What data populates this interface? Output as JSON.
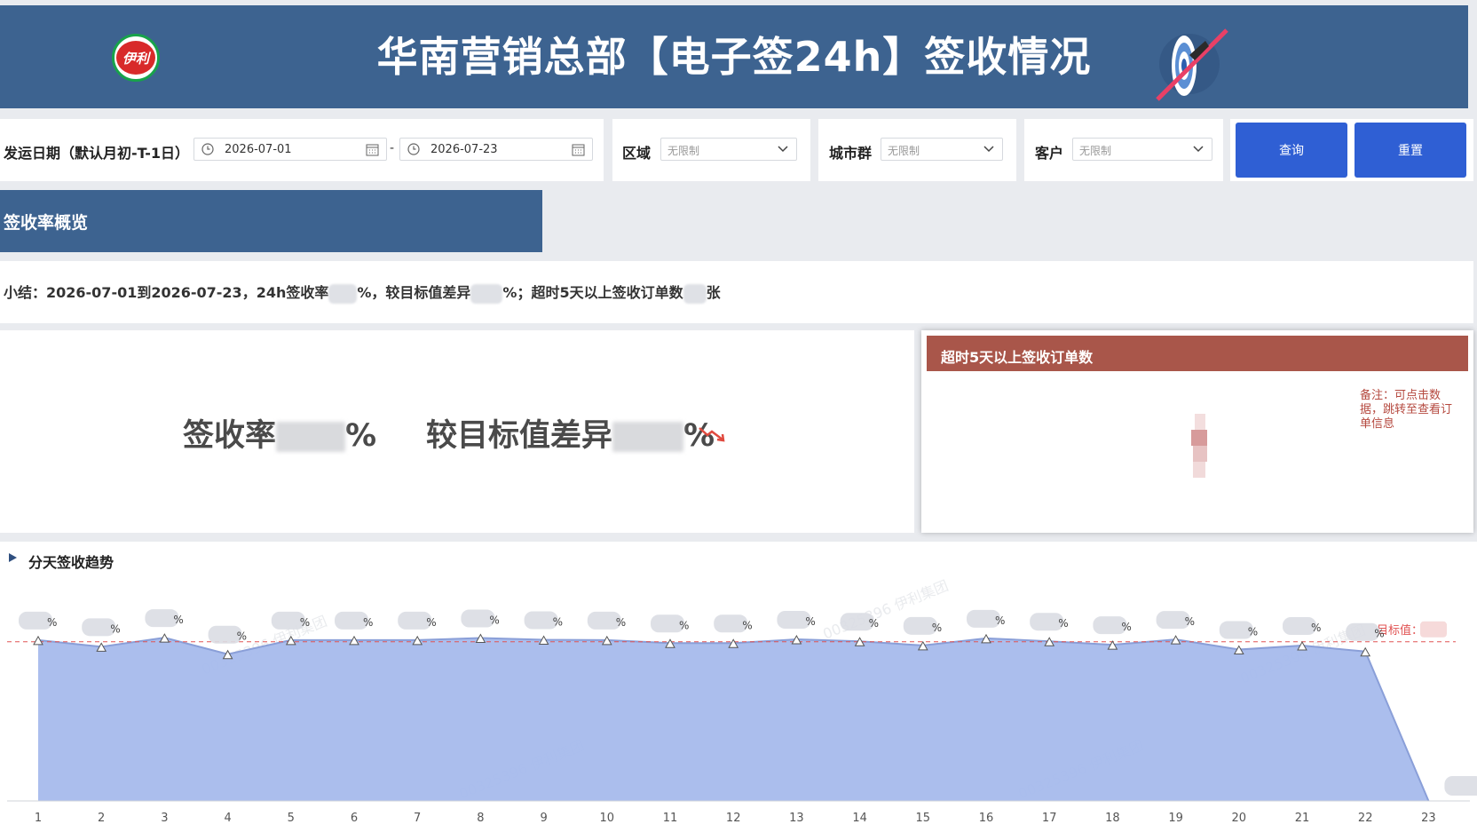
{
  "header": {
    "logo_text": "伊利",
    "title": "华南营销总部【电子签24h】签收情况"
  },
  "filters": {
    "date_label": "发运日期（默认月初-T-1日）",
    "start_date": "2026-07-01",
    "date_separator": "-",
    "end_date": "2026-07-23",
    "region_label": "区域",
    "region_value": "无限制",
    "city_label": "城市群",
    "city_value": "无限制",
    "customer_label": "客户",
    "customer_value": "无限制",
    "query_label": "查询",
    "reset_label": "重置"
  },
  "overview": {
    "section_title": "签收率概览",
    "summary_part1": "小结：2026-07-01到2026-07-23，24h签收率",
    "summary_part2": "%，较目标值差异",
    "summary_part3": "%；超时5天以上签收订单数",
    "summary_part4": "张",
    "kpi_rate_label": "签收率",
    "kpi_rate_unit": "%",
    "kpi_diff_label": "较目标值差异",
    "kpi_diff_unit": "%",
    "trend_icon": "trend-down-icon",
    "accent_color": "#3d6390"
  },
  "overtime": {
    "title": "超时5天以上签收订单数",
    "note": "备注：可点击数据，跳转至查看订单信息",
    "header_color": "#a9564a"
  },
  "trend": {
    "title": "分天签收趋势",
    "target_label": "目标值：",
    "watermark": "00325396 伊利集团"
  },
  "chart_data": {
    "type": "area",
    "title": "分天签收趋势",
    "categories": [
      "1",
      "2",
      "3",
      "4",
      "5",
      "6",
      "7",
      "8",
      "9",
      "10",
      "11",
      "12",
      "13",
      "14",
      "15",
      "16",
      "17",
      "18",
      "19",
      "20",
      "21",
      "22",
      "23"
    ],
    "series": [
      {
        "values": [
          97.5,
          93.5,
          99.0,
          89.0,
          97.5,
          97.5,
          97.5,
          98.8,
          97.7,
          97.5,
          95.7,
          95.7,
          98.0,
          96.8,
          94.3,
          98.6,
          96.8,
          94.7,
          97.9,
          91.8,
          94.2,
          90.6,
          0
        ],
        "color": "#a7bbec",
        "line_color": "#8a9fd8"
      }
    ],
    "target_line": {
      "value": 96.5,
      "color": "#e15353",
      "style": "dashed"
    },
    "ylim": [
      0,
      105
    ],
    "grid": false,
    "legend": "none"
  }
}
